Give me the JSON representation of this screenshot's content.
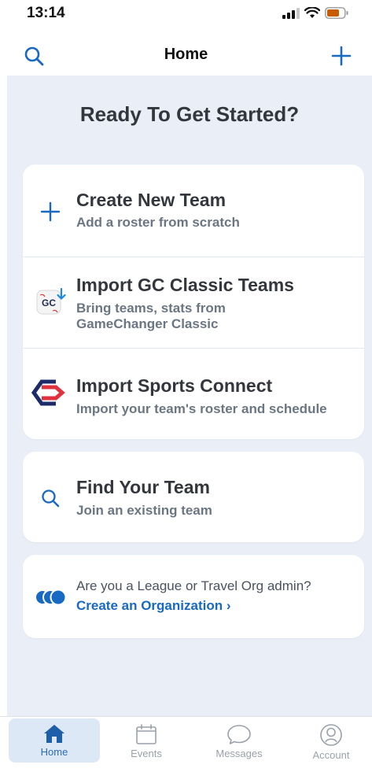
{
  "status_bar": {
    "time": "13:14"
  },
  "nav": {
    "title": "Home"
  },
  "headline": "Ready To Get Started?",
  "team_options": [
    {
      "title": "Create New Team",
      "subtitle": "Add a roster from scratch"
    },
    {
      "title": "Import GC Classic Teams",
      "subtitle_line1": "Bring teams, stats from",
      "subtitle_line2": "GameChanger Classic",
      "badge": "GC"
    },
    {
      "title": "Import Sports Connect",
      "subtitle": "Import your team's roster and schedule"
    }
  ],
  "find_team": {
    "title": "Find Your Team",
    "subtitle": "Join an existing team"
  },
  "organization": {
    "question": "Are you a League or Travel Org admin?",
    "link": "Create an Organization ›"
  },
  "tabs": [
    {
      "label": "Home",
      "icon": "home-icon"
    },
    {
      "label": "Events",
      "icon": "calendar-icon"
    },
    {
      "label": "Messages",
      "icon": "chat-bubble-icon"
    },
    {
      "label": "Account",
      "icon": "user-circle-icon"
    }
  ],
  "colors": {
    "accent": "#1769c2",
    "background": "#e9eef7",
    "card": "#ffffff",
    "sports_connect_red": "#e0313f",
    "sports_connect_navy": "#1d2b6b"
  }
}
